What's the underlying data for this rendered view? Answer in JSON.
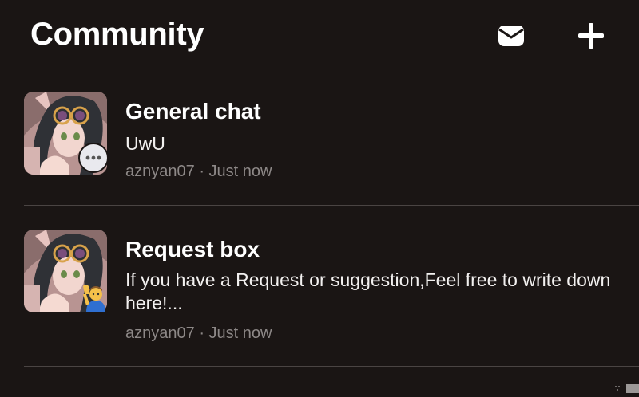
{
  "header": {
    "title": "Community",
    "inbox_icon": "envelope-icon",
    "create_icon": "plus-icon"
  },
  "posts": [
    {
      "title": "General chat",
      "body": "UwU",
      "author": "aznyan07",
      "separator": "·",
      "time": "Just now",
      "badge_icon": "speech-bubble-icon"
    },
    {
      "title": "Request box",
      "body": "If you have a Request or suggestion,Feel free to write down here!...",
      "author": "aznyan07",
      "separator": "·",
      "time": "Just now",
      "badge_icon": "raising-hand-emoji-icon"
    }
  ],
  "colors": {
    "background": "#1a1514",
    "text_primary": "#ffffff",
    "text_meta": "#8d8887",
    "divider": "#4a4443"
  }
}
